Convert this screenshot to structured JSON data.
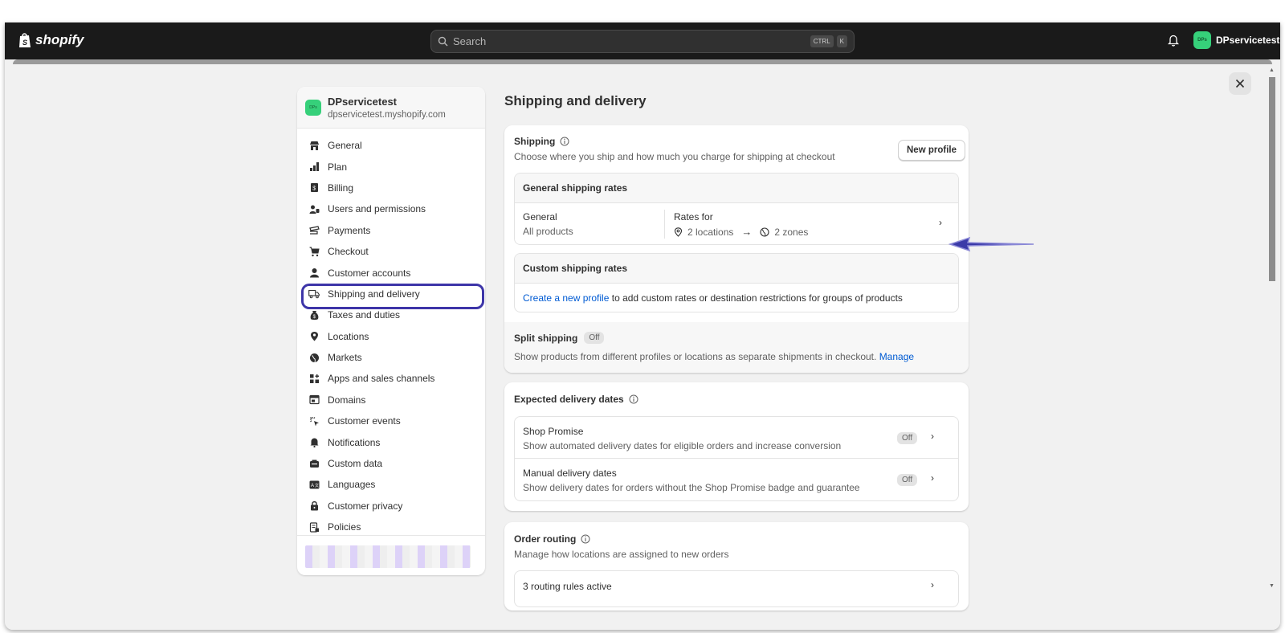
{
  "topbar": {
    "logo_text": "shopify",
    "search_placeholder": "Search",
    "shortcut_keys": [
      "CTRL",
      "K"
    ],
    "store_button_label": "DPservicetest",
    "avatar_initials": "DPs"
  },
  "sidebar": {
    "store_name": "DPservicetest",
    "store_url": "dpservicetest.myshopify.com",
    "avatar_initials": "DPs",
    "items": [
      {
        "label": "General",
        "icon": "store-icon"
      },
      {
        "label": "Plan",
        "icon": "plan-icon"
      },
      {
        "label": "Billing",
        "icon": "billing-icon"
      },
      {
        "label": "Users and permissions",
        "icon": "users-icon"
      },
      {
        "label": "Payments",
        "icon": "payments-icon"
      },
      {
        "label": "Checkout",
        "icon": "cart-icon"
      },
      {
        "label": "Customer accounts",
        "icon": "person-icon"
      },
      {
        "label": "Shipping and delivery",
        "icon": "truck-icon",
        "active": true
      },
      {
        "label": "Taxes and duties",
        "icon": "tax-icon"
      },
      {
        "label": "Locations",
        "icon": "location-icon"
      },
      {
        "label": "Markets",
        "icon": "globe-icon"
      },
      {
        "label": "Apps and sales channels",
        "icon": "apps-icon"
      },
      {
        "label": "Domains",
        "icon": "domain-icon"
      },
      {
        "label": "Customer events",
        "icon": "cursor-icon"
      },
      {
        "label": "Notifications",
        "icon": "bell-icon"
      },
      {
        "label": "Custom data",
        "icon": "data-icon"
      },
      {
        "label": "Languages",
        "icon": "language-icon"
      },
      {
        "label": "Customer privacy",
        "icon": "lock-icon"
      },
      {
        "label": "Policies",
        "icon": "policy-icon"
      }
    ]
  },
  "page": {
    "title": "Shipping and delivery"
  },
  "shipping": {
    "title": "Shipping",
    "description": "Choose where you ship and how much you charge for shipping at checkout",
    "new_profile_button": "New profile",
    "general_rates": {
      "header": "General shipping rates",
      "name": "General",
      "subtitle": "All products",
      "rates_for_label": "Rates for",
      "locations": "2 locations",
      "zones": "2 zones"
    },
    "custom_rates": {
      "header": "Custom shipping rates",
      "link_text": "Create a new profile",
      "text": "to add custom rates or destination restrictions for groups of products"
    },
    "split": {
      "title": "Split shipping",
      "badge": "Off",
      "description": "Show products from different profiles or locations as separate shipments in checkout.",
      "manage_link": "Manage"
    }
  },
  "delivery_dates": {
    "title": "Expected delivery dates",
    "rows": [
      {
        "title": "Shop Promise",
        "description": "Show automated delivery dates for eligible orders and increase conversion",
        "badge": "Off"
      },
      {
        "title": "Manual delivery dates",
        "description": "Show delivery dates for orders without the Shop Promise badge and guarantee",
        "badge": "Off"
      }
    ]
  },
  "order_routing": {
    "title": "Order routing",
    "description": "Manage how locations are assigned to new orders",
    "rules_label": "3 routing rules active"
  },
  "colors": {
    "topbar": "#1a1a1a",
    "accent_link": "#005bd3",
    "highlight_outline": "#3d35a8",
    "annotation_arrow": "#3b3aa8"
  }
}
